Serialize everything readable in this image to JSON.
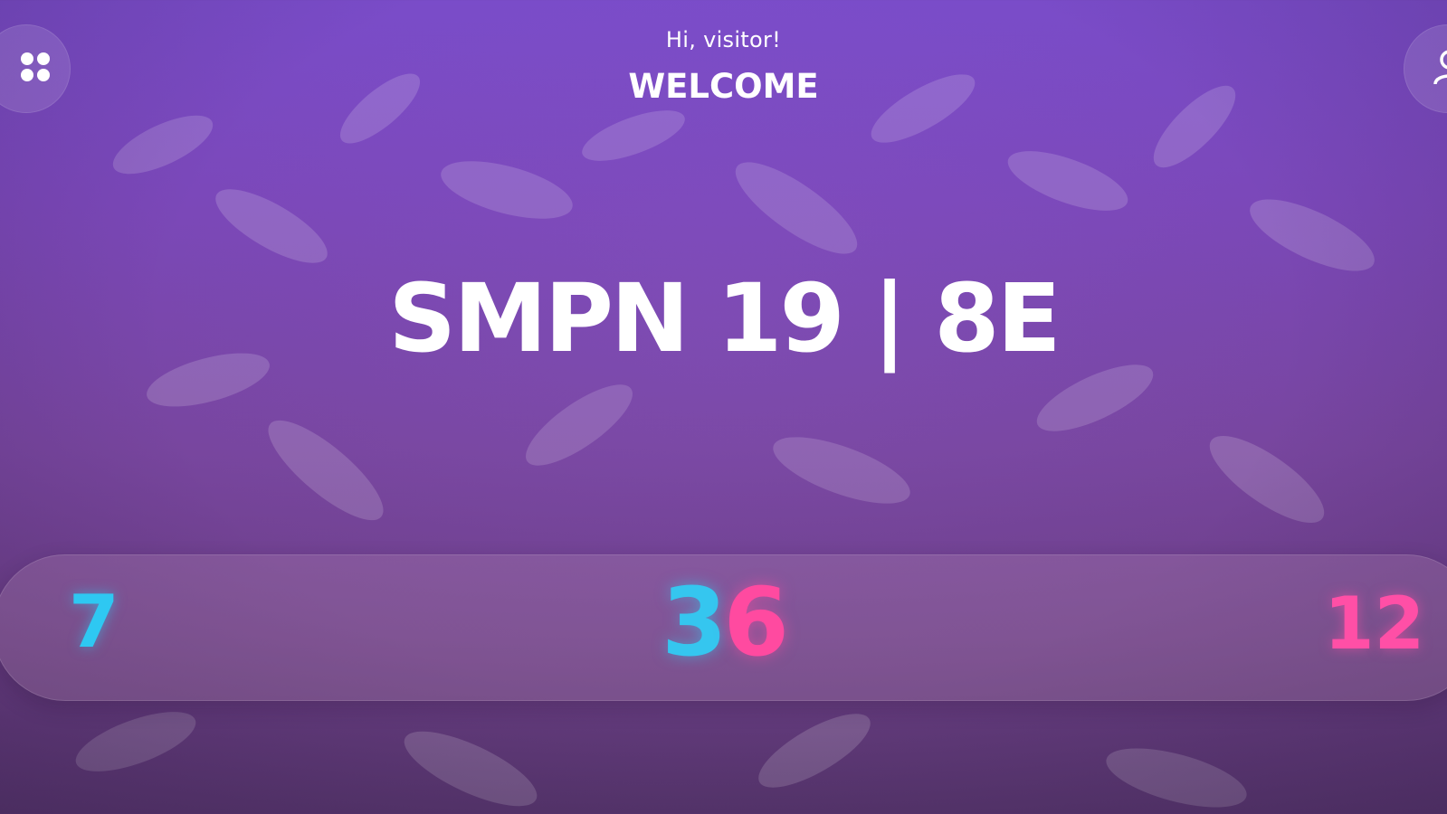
{
  "header": {
    "greeting": "Hi, visitor!",
    "title": "WELCOME"
  },
  "main": {
    "school_class": "SMPN 19 | 8E"
  },
  "stats": {
    "boys": "7",
    "total_digit_1": "3",
    "total_digit_2": "6",
    "girls": "12"
  },
  "icons": {
    "menu": "grid-dots-icon",
    "user": "user-icon"
  },
  "colors": {
    "boys_accent": "#2ec8f2",
    "girls_accent": "#ff4fa6",
    "background": "#7a4cc9"
  }
}
